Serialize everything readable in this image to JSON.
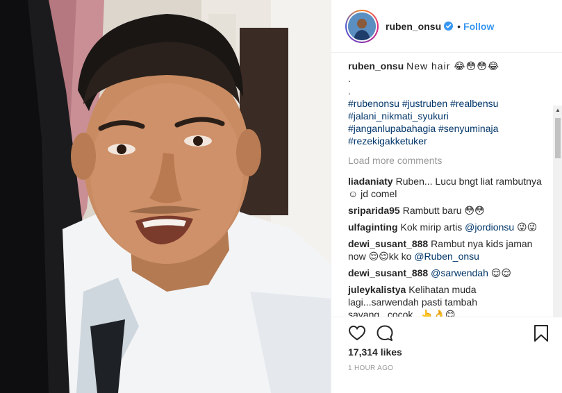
{
  "post": {
    "author": "ruben_onsu",
    "follow_label": "Follow",
    "separator": "•",
    "photo_alt": "Selfie of man with short hair in white t-shirt"
  },
  "caption": {
    "username": "ruben_onsu",
    "text": "New hair 😂😳😳😂",
    "dots": [
      ".",
      "."
    ],
    "hashtag_lines": [
      "#rubenonsu #justruben #realbensu",
      "#jalani_nikmati_syukuri",
      "#janganlupabahagia #senyuminaja",
      "#rezekigakketuker"
    ]
  },
  "load_more": "Load more comments",
  "comments": [
    {
      "username": "liadaniaty",
      "text": "Ruben... Lucu bngt liat rambutnya ☺ jd comel"
    },
    {
      "username": "sriparida95",
      "text": "Rambutt baru 😳😳"
    },
    {
      "username": "ulfaginting",
      "text": "Kok mirip artis ",
      "mention": "@jordionsu",
      "suffix": " 😜😜"
    },
    {
      "username": "dewi_susant_888",
      "text": "Rambut nya kids jaman now 😌😌kk ko ",
      "mention": "@Ruben_onsu",
      "suffix": ""
    },
    {
      "username": "dewi_susant_888",
      "text": "",
      "mention": "@sarwendah",
      "suffix": " 😌😌"
    },
    {
      "username": "juleykalistya",
      "text": "Kelihatan muda lagi...sarwendah pasti tambah sayang...cocok...👆👌😊"
    }
  ],
  "likes": "17,314 likes",
  "timestamp": "1 HOUR AGO",
  "icons": {
    "like": "heart-outline-icon",
    "comment": "speech-bubble-icon",
    "save": "bookmark-icon",
    "verified": "verified-badge-icon"
  },
  "colors": {
    "link": "#003569",
    "follow": "#3897f0",
    "verified": "#3897f0",
    "muted": "#999999"
  }
}
